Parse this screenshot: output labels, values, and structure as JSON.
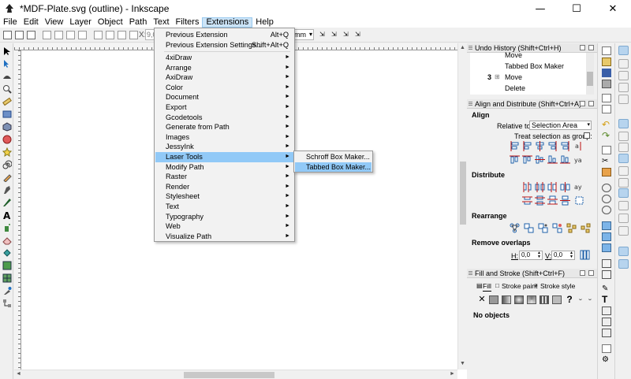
{
  "window": {
    "title": "*MDF-Plate.svg (outline) - Inkscape",
    "minimize": "—",
    "maximize": "☐",
    "close": "✕"
  },
  "menubar": {
    "items": [
      "File",
      "Edit",
      "View",
      "Layer",
      "Object",
      "Path",
      "Text",
      "Filters",
      "Extensions",
      "Help"
    ],
    "active": "Extensions"
  },
  "commandbar": {
    "x_label": "X:",
    "x_value": "9,0",
    "unit": "mm"
  },
  "extensions_menu": {
    "items": [
      {
        "label": "Previous Extension",
        "shortcut": "Alt+Q",
        "submenu": false
      },
      {
        "label": "Previous Extension Settings...",
        "shortcut": "Shift+Alt+Q",
        "submenu": false
      },
      {
        "label": "4xiDraw",
        "submenu": true
      },
      {
        "label": "Arrange",
        "submenu": true
      },
      {
        "label": "AxiDraw",
        "submenu": true
      },
      {
        "label": "Color",
        "submenu": true
      },
      {
        "label": "Document",
        "submenu": true
      },
      {
        "label": "Export",
        "submenu": true
      },
      {
        "label": "Gcodetools",
        "submenu": true
      },
      {
        "label": "Generate from Path",
        "submenu": true
      },
      {
        "label": "Images",
        "submenu": true
      },
      {
        "label": "JessyInk",
        "submenu": true
      },
      {
        "label": "Laser Tools",
        "submenu": true,
        "highlighted": true
      },
      {
        "label": "Modify Path",
        "submenu": true
      },
      {
        "label": "Raster",
        "submenu": true
      },
      {
        "label": "Render",
        "submenu": true
      },
      {
        "label": "Stylesheet",
        "submenu": true
      },
      {
        "label": "Text",
        "submenu": true
      },
      {
        "label": "Typography",
        "submenu": true
      },
      {
        "label": "Web",
        "submenu": true
      },
      {
        "label": "Visualize Path",
        "submenu": true
      }
    ],
    "arrow_glyph": "►"
  },
  "laser_tools_submenu": {
    "items": [
      {
        "label": "Schroff Box Maker...",
        "highlighted": false
      },
      {
        "label": "Tabbed Box Maker...",
        "highlighted": true
      }
    ]
  },
  "undo_history": {
    "title": "Undo History (Shift+Ctrl+H)",
    "rows": [
      {
        "num": "",
        "expander": "",
        "label": "Move"
      },
      {
        "num": "",
        "expander": "",
        "label": "Tabbed Box Maker"
      },
      {
        "num": "3",
        "expander": "⊞",
        "label": "Move"
      },
      {
        "num": "",
        "expander": "",
        "label": "Delete"
      }
    ]
  },
  "align_distribute": {
    "title": "Align and Distribute (Shift+Ctrl+A)",
    "align_heading": "Align",
    "relative_to_label": "Relative to:",
    "relative_to_value": "Selection Area",
    "treat_as_group_label": "Treat selection as group:",
    "distribute_heading": "Distribute",
    "rearrange_heading": "Rearrange",
    "remove_overlaps_heading": "Remove overlaps",
    "h_label": "H:",
    "h_value": "0,0",
    "v_label": "V:",
    "v_value": "0,0"
  },
  "fill_stroke": {
    "title": "Fill and Stroke (Shift+Ctrl+F)",
    "tabs": [
      "Fill",
      "Stroke paint",
      "Stroke style"
    ],
    "active_tab": "Fill",
    "paint_types": [
      "no-paint",
      "flat-color",
      "linear-gradient",
      "radial-gradient",
      "mesh-gradient",
      "pattern",
      "swatch",
      "unset",
      "unset-alt",
      "unset-alt2"
    ],
    "no_paint_glyph": "✕",
    "unknown_glyph": "?",
    "status": "No objects"
  },
  "colors": {
    "menu_highlight": "#91c9f7",
    "menubar_active": "#cce4f7",
    "toggle_on": "#b7d4ee"
  }
}
